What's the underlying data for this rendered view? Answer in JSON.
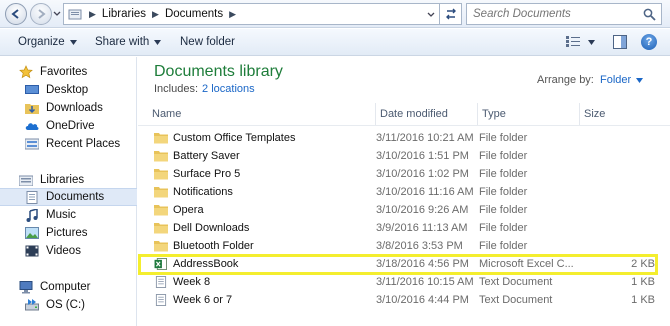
{
  "address_bar": {
    "breadcrumbs": [
      "Libraries",
      "Documents"
    ],
    "search_placeholder": "Search Documents"
  },
  "toolbar": {
    "organize_label": "Organize",
    "share_label": "Share with",
    "new_folder_label": "New folder"
  },
  "nav": {
    "favorites": "Favorites",
    "desktop": "Desktop",
    "downloads": "Downloads",
    "onedrive": "OneDrive",
    "recent": "Recent Places",
    "libraries": "Libraries",
    "documents": "Documents",
    "music": "Music",
    "pictures": "Pictures",
    "videos": "Videos",
    "computer": "Computer",
    "osc": "OS (C:)"
  },
  "library": {
    "title": "Documents library",
    "includes_label": "Includes:",
    "locations": "2 locations",
    "arrange_label": "Arrange by:",
    "arrange_value": "Folder"
  },
  "columns": {
    "name": "Name",
    "date": "Date modified",
    "type": "Type",
    "size": "Size"
  },
  "files": [
    {
      "name": "Custom Office Templates",
      "date": "3/11/2016 10:21 AM",
      "type": "File folder",
      "size": "",
      "icon": "folder-icon"
    },
    {
      "name": "Battery Saver",
      "date": "3/10/2016 1:51 PM",
      "type": "File folder",
      "size": "",
      "icon": "folder-icon"
    },
    {
      "name": "Surface Pro 5",
      "date": "3/10/2016 1:02 PM",
      "type": "File folder",
      "size": "",
      "icon": "folder-icon"
    },
    {
      "name": "Notifications",
      "date": "3/10/2016 11:16 AM",
      "type": "File folder",
      "size": "",
      "icon": "folder-icon"
    },
    {
      "name": "Opera",
      "date": "3/10/2016 9:26 AM",
      "type": "File folder",
      "size": "",
      "icon": "folder-icon"
    },
    {
      "name": "Dell Downloads",
      "date": "3/9/2016 11:13 AM",
      "type": "File folder",
      "size": "",
      "icon": "folder-icon"
    },
    {
      "name": "Bluetooth Folder",
      "date": "3/8/2016 3:53 PM",
      "type": "File folder",
      "size": "",
      "icon": "folder-icon"
    },
    {
      "name": "AddressBook",
      "date": "3/18/2016 4:56 PM",
      "type": "Microsoft Excel C...",
      "size": "2 KB",
      "icon": "excel-csv-icon"
    },
    {
      "name": "Week 8",
      "date": "3/11/2016 10:15 AM",
      "type": "Text Document",
      "size": "1 KB",
      "icon": "text-document-icon"
    },
    {
      "name": "Week 6 or 7",
      "date": "3/10/2016 4:44 PM",
      "type": "Text Document",
      "size": "1 KB",
      "icon": "text-document-icon"
    }
  ],
  "colors": {
    "highlight": "#f4ee2e",
    "library_title": "#1e7d3a",
    "link": "#1b67c7",
    "folder": "#e8c35a"
  }
}
